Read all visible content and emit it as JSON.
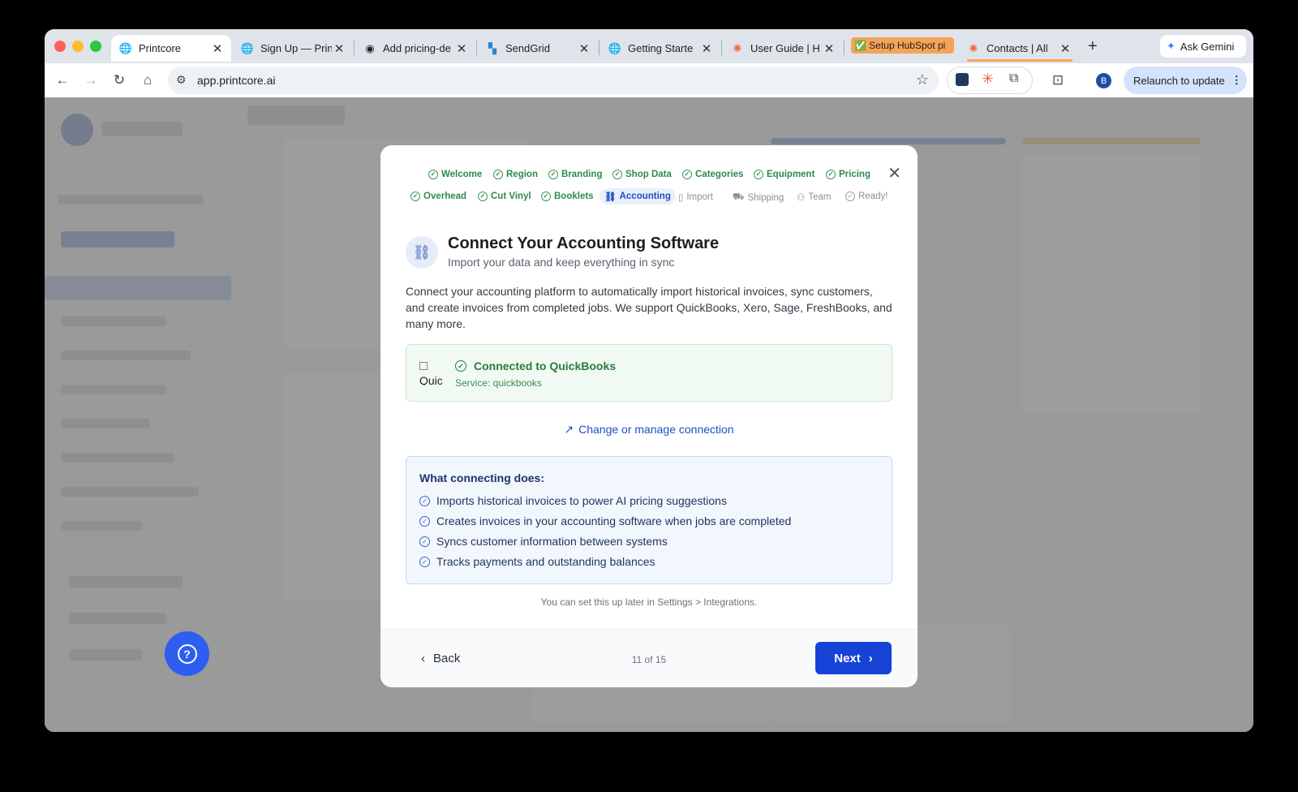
{
  "browser": {
    "tabs": [
      {
        "label": "Printcore",
        "icon": "globe-icon"
      },
      {
        "label": "Sign Up — Prin",
        "icon": "globe-icon"
      },
      {
        "label": "Add pricing-de",
        "icon": "github-icon"
      },
      {
        "label": "SendGrid",
        "icon": "sendgrid-icon"
      },
      {
        "label": "Getting Starte",
        "icon": "globe-icon"
      },
      {
        "label": "User Guide | H",
        "icon": "hubspot-icon"
      },
      {
        "label": "✅ Setup HubSpot pi",
        "icon": ""
      },
      {
        "label": "Contacts | All",
        "icon": "hubspot-icon"
      }
    ],
    "gemini_label": "Ask Gemini",
    "url": "app.printcore.ai",
    "profile_initial": "B",
    "relaunch_label": "Relaunch to update"
  },
  "wizard": {
    "steps_row1": [
      {
        "label": "Welcome",
        "state": "done"
      },
      {
        "label": "Region",
        "state": "done"
      },
      {
        "label": "Branding",
        "state": "done"
      },
      {
        "label": "Shop Data",
        "state": "done"
      },
      {
        "label": "Categories",
        "state": "done"
      },
      {
        "label": "Equipment",
        "state": "done"
      },
      {
        "label": "Pricing",
        "state": "done"
      }
    ],
    "steps_row2": [
      {
        "label": "Overhead",
        "state": "done"
      },
      {
        "label": "Cut Vinyl",
        "state": "done"
      },
      {
        "label": "Booklets",
        "state": "done"
      },
      {
        "label": "Accounting",
        "state": "current"
      },
      {
        "label": "Import",
        "state": "pending"
      },
      {
        "label": "Shipping",
        "state": "pending"
      },
      {
        "label": "Team",
        "state": "pending"
      },
      {
        "label": "Ready!",
        "state": "pending"
      }
    ],
    "title": "Connect Your Accounting Software",
    "subtitle": "Import your data and keep everything in sync",
    "description": "Connect your accounting platform to automatically import historical invoices, sync customers, and create invoices from completed jobs. We support QuickBooks, Xero, Sage, FreshBooks, and many more.",
    "connection": {
      "img_alt": "Quic",
      "title": "Connected to QuickBooks",
      "service": "Service: quickbooks"
    },
    "change_link": "Change or manage connection",
    "info_title": "What connecting does:",
    "info_items": [
      "Imports historical invoices to power AI pricing suggestions",
      "Creates invoices in your accounting software when jobs are completed",
      "Syncs customer information between systems",
      "Tracks payments and outstanding balances"
    ],
    "later_note": "You can set this up later in Settings > Integrations.",
    "back_label": "Back",
    "pager": "11 of 15",
    "next_label": "Next"
  },
  "colors": {
    "accent": "#1742d6",
    "success": "#2f8a4c",
    "highlight_tab": "#f6a35a"
  }
}
